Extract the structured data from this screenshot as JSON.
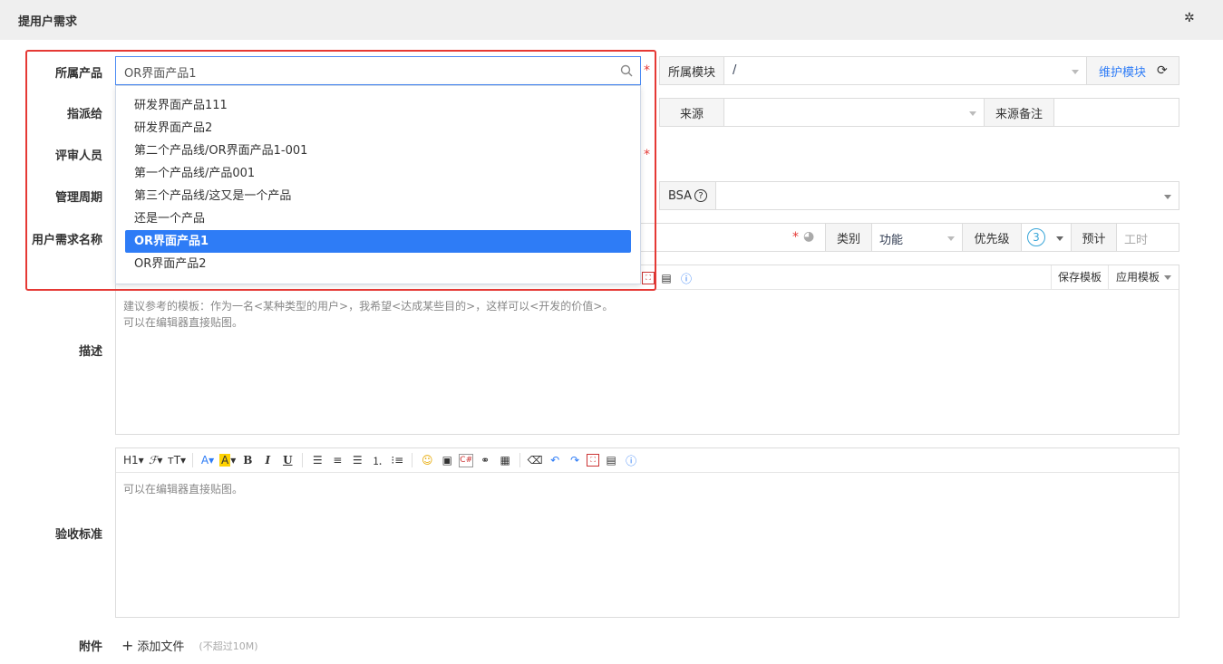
{
  "header": {
    "title": "提用户需求",
    "settings_icon": "gear-icon"
  },
  "labels": {
    "product": "所属产品",
    "assign": "指派给",
    "reviewer": "评审人员",
    "cycle": "管理周期",
    "name": "用户需求名称",
    "desc": "描述",
    "verify": "验收标准",
    "attach": "附件"
  },
  "product": {
    "search_value": "OR界面产品1",
    "options": [
      "研发界面产品111",
      "研发界面产品2",
      "第二个产品线/OR界面产品1-001",
      "第一个产品线/产品001",
      "第三个产品线/这又是一个产品",
      "还是一个产品",
      "OR界面产品1",
      "OR界面产品2"
    ],
    "selected_index": 6
  },
  "module": {
    "label": "所属模块",
    "value": "/",
    "maintain_link": "维护模块"
  },
  "source": {
    "label": "来源",
    "note_label": "来源备注"
  },
  "bsa": {
    "label": "BSA"
  },
  "category": {
    "label": "类别",
    "value": "功能"
  },
  "priority": {
    "label": "优先级",
    "value": "3"
  },
  "estimate": {
    "label": "预计",
    "placeholder": "工时"
  },
  "templates": {
    "save": "保存模板",
    "apply": "应用模板"
  },
  "desc": {
    "placeholder_line1": "建议参考的模板：作为一名<某种类型的用户>，我希望<达成某些目的>，这样可以<开发的价值>。",
    "placeholder_line2": "可以在编辑器直接贴图。"
  },
  "verify": {
    "placeholder": "可以在编辑器直接贴图。"
  },
  "attach": {
    "add_label": "添加文件",
    "limit": "(不超过10M)"
  },
  "toolbar": {
    "h1": "H1",
    "bold": "B",
    "italic": "I",
    "underline": "U"
  },
  "colors": {
    "accent": "#2e7cf6",
    "required": "#e53935",
    "link": "#2e7cf6"
  }
}
